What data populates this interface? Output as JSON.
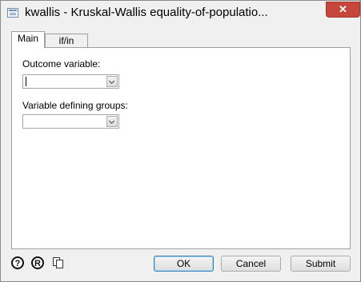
{
  "window": {
    "title": "kwallis - Kruskal-Wallis equality-of-populatio...",
    "icon": "dialog-icon",
    "close_glyph": "✕"
  },
  "tabs": [
    {
      "label": "Main",
      "selected": true
    },
    {
      "label": "if/in",
      "selected": false
    }
  ],
  "main": {
    "outcome_label": "Outcome variable:",
    "outcome_value": "",
    "groups_label": "Variable defining groups:",
    "groups_value": ""
  },
  "footer": {
    "help_glyph": "?",
    "reset_glyph": "R",
    "ok_label": "OK",
    "cancel_label": "Cancel",
    "submit_label": "Submit"
  }
}
